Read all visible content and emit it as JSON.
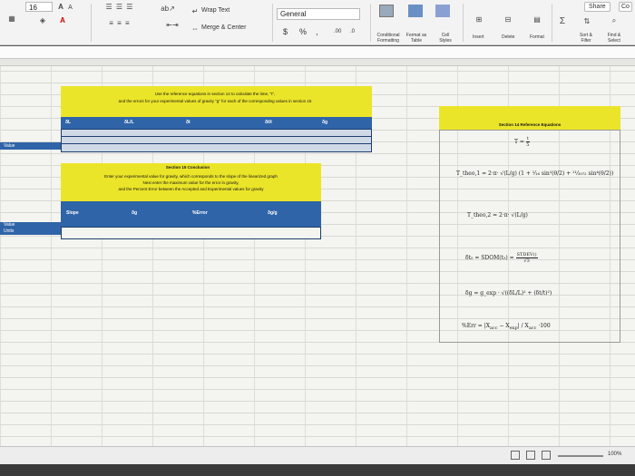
{
  "ribbon": {
    "font_size": "16",
    "font_grow": "A",
    "font_shrink": "A",
    "wrap_text": "Wrap Text",
    "merge_center": "Merge & Center",
    "number_format": "General",
    "currency": "$",
    "percent": "%",
    "comma": ",",
    "increase_decimal": ".00",
    "decrease_decimal": ".0",
    "conditional_formatting": "Conditional Formatting",
    "format_as_table": "Format as Table",
    "cell_styles": "Cell Styles",
    "insert": "Insert",
    "delete": "Delete",
    "format": "Format",
    "sort_filter": "Sort & Filter",
    "find_select": "Find & Select",
    "share": "Share",
    "comments": "Co"
  },
  "sheet": {
    "top_table": {
      "title_line1": "Use the reference equations in section 14 to calculate the time, \"t\",",
      "title_line2": "and the errors for your experimental values of gravity \"g\" for each of the corresponding values in section 15",
      "col1": "δL",
      "col2": "δL/L",
      "col3": "δt",
      "col4": "δt/t",
      "col5": "δg",
      "side_label": "Value"
    },
    "bottom_table": {
      "section_title": "Section 15 Conclusion",
      "text1": "Enter your experimental value for gravity, which corresponds to the slope of the linearized graph",
      "text2": "Next enter the maximum value for the error in gravity,",
      "text3": "and the Percent Error between the Accepted and Experimental values for gravity",
      "col1": "Slope",
      "col2": "δg",
      "col3": "%Error",
      "col4": "δg/g",
      "side_label1": "Value",
      "side_label2": "Units"
    },
    "right_panel": {
      "title": "Section 14 Reference Equations",
      "eq_t": "T =",
      "eq_t_num": "t",
      "eq_t_den": "5",
      "eq_theo1": "T_theo,1 = 2·π·",
      "eq_theo2": "T_theo,2 = 2·π·",
      "eq_dt": "δt₅ = SDOM(t₅) =",
      "eq_dt_num": "STDEV()",
      "eq_dt_den": "√3",
      "eq_dg": "δg = g_exp ·",
      "eq_err": "%Err =",
      "eq_err_tail": "·100"
    }
  },
  "status_bar": {
    "zoom": "100%"
  },
  "colors": {
    "table_yellow": "#ebe52a",
    "table_blue": "#2f64a8",
    "grid": "#f4f4f0"
  }
}
